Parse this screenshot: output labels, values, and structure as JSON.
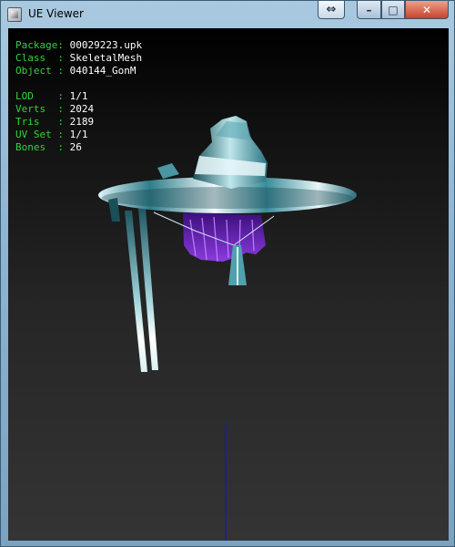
{
  "window": {
    "title": "UE Viewer"
  },
  "titlebar_buttons": {
    "swap_icon": "⇔",
    "minimize_icon": "–",
    "maximize_icon": "□",
    "close_icon": "✕"
  },
  "info": {
    "package": {
      "label": "Package:",
      "value": "00029223.upk"
    },
    "class": {
      "label": "Class  :",
      "value": "SkeletalMesh"
    },
    "object": {
      "label": "Object :",
      "value": "040144_GonM"
    },
    "lod": {
      "label": "LOD    :",
      "value": "1/1"
    },
    "verts": {
      "label": "Verts  :",
      "value": "2024"
    },
    "tris": {
      "label": "Tris   :",
      "value": "2189"
    },
    "uvset": {
      "label": "UV Set :",
      "value": "1/1"
    },
    "bones": {
      "label": "Bones  :",
      "value": "26"
    }
  },
  "colors": {
    "label": "#34d23c",
    "value": "#ffffff",
    "axis": "#1c1ca8",
    "hat": "#3d8f9c",
    "hair": "#7b2fd0"
  }
}
